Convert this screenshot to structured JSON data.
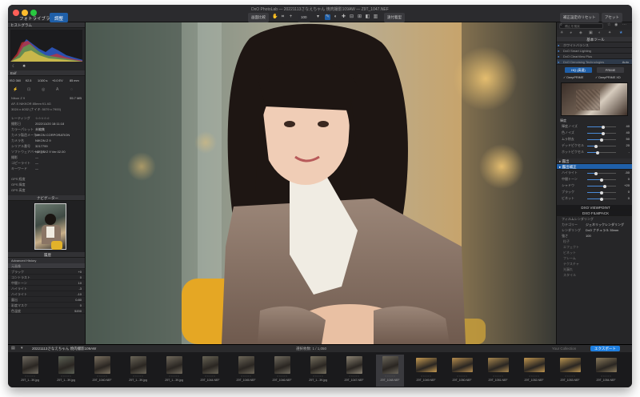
{
  "window": {
    "title": "DxO PhotoLab — 20221113さなえちゃん 焼肉撮影109AW — Z9T_1047.NEF"
  },
  "tabs": [
    {
      "label": "フォトライブラリ"
    },
    {
      "label": "調整"
    }
  ],
  "toolbar": {
    "compare_label": "画面比較",
    "zoom_value": "100",
    "wb_label": "遠付着型",
    "right_button_1": "補正設定のリセット",
    "right_button_2": "アセット"
  },
  "left_panel": {
    "histogram_title": "ヒストグラム",
    "exif_title": "Exif",
    "exif_values": [
      "ISO 360",
      "f/2.5",
      "1/100 s",
      "+0.0 EV",
      "85 mm"
    ],
    "camera": "Nikon Z 9",
    "camera_size": "55.7 MB",
    "lens": "AF-S NIKKOR 85mm f/1.4G",
    "file_info": "3024 x 4032 (ナイキ: 5079 x 7900)",
    "metadata": [
      {
        "label": "レーティング",
        "value": "☆☆☆☆☆"
      },
      {
        "label": "撮影日",
        "value": "2022/11/20 18:11:18"
      },
      {
        "label": "カラーパレット",
        "value": "未編集"
      },
      {
        "label": "カメラ製造メーカー",
        "value": "NIKON CORPORATION"
      },
      {
        "label": "カメラ名",
        "value": "NIKON Z 9"
      },
      {
        "label": "シリアル番号",
        "value": "3217799"
      },
      {
        "label": "ソフトウェアバージョン",
        "value": "NIKON Z 9 Ver.02.00"
      },
      {
        "label": "撮影",
        "value": "—"
      },
      {
        "label": "コピーライト",
        "value": "—"
      },
      {
        "label": "キーワード",
        "value": "—"
      }
    ],
    "gps": [
      {
        "label": "GPS 経度"
      },
      {
        "label": "GPS 緯度"
      },
      {
        "label": "GPS 高度"
      }
    ],
    "navigator_title": "ナビゲーター",
    "history_title": "履歴",
    "history_sub": "Advanced History",
    "history_items": [
      {
        "label": "元画像",
        "value": ""
      },
      {
        "label": "ブラック",
        "value": "+0"
      },
      {
        "label": "コントラスト",
        "value": "0"
      },
      {
        "label": "中間トーン",
        "value": "10"
      },
      {
        "label": "ハイライト",
        "value": "-3"
      },
      {
        "label": "ハイライト",
        "value": "-10"
      },
      {
        "label": "露出",
        "value": "0.80"
      },
      {
        "label": "彩度マスク",
        "value": "0"
      },
      {
        "label": "色温度",
        "value": "5200"
      }
    ]
  },
  "right_panel": {
    "search_placeholder": "補正を検索",
    "section_title": "基本ツール",
    "items": [
      {
        "label": "ホワイトバランス"
      },
      {
        "label": "DxO Smart Lighting"
      },
      {
        "label": "DxO ClearView Plus"
      },
      {
        "label": "DxO Denoising Technologies",
        "value": "Auto"
      }
    ],
    "denoise_options": [
      "HQ (高速)",
      "PRIME"
    ],
    "denoise_check": [
      "DeepPRIME",
      "DeepPRIME XD"
    ],
    "luminance_title": "輝度",
    "sliders": [
      {
        "label": "輝度ノイズ",
        "value": "40",
        "pos": 0.55
      },
      {
        "label": "色ノイズ",
        "value": "40",
        "pos": 0.55
      },
      {
        "label": "ムラ除去",
        "value": "50",
        "pos": 0.5
      },
      {
        "label": "デッドピクセル",
        "value": "20",
        "pos": 0.3
      },
      {
        "label": "ホットピクセル",
        "value": "-",
        "pos": 0.35
      }
    ],
    "sub_sections": [
      "露出",
      "露出補正"
    ],
    "tone_sliders": [
      {
        "label": "ハイライト",
        "value": "-50",
        "pos": 0.3
      },
      {
        "label": "中間トーン",
        "value": "0",
        "pos": 0.5
      },
      {
        "label": "シャドウ",
        "value": "+20",
        "pos": 0.6
      },
      {
        "label": "ブラック",
        "value": "0",
        "pos": 0.5
      },
      {
        "label": "ビネット",
        "value": "0",
        "pos": 0.5
      }
    ],
    "headers": [
      "DXO VIEWPOINT",
      "DXO FILMPACK"
    ],
    "filmpack_rows": [
      {
        "label": "フィルムレンダリング",
        "value": ""
      },
      {
        "label": "カテゴリー",
        "value": "ジェネリックレンダリング"
      },
      {
        "label": "レンダリング",
        "value": "DxO ナチュラル 35mm"
      },
      {
        "label": "強さ",
        "value": "100"
      }
    ],
    "extra_rows": [
      "粒子",
      "エフェクト",
      "ビネット",
      "フレーム",
      "テクスチャ",
      "光漏れ",
      "スタイル"
    ]
  },
  "filmstrip": {
    "folder": "20221113さなえちゃん 焼肉撮影109AW",
    "count": "1,050",
    "selected_count": "選択枚数: 1 / 1,050",
    "right_label": "Your Collection",
    "export_button": "エクスポート",
    "thumbs": [
      {
        "name": "Z9T_1...39.jpg"
      },
      {
        "name": "Z9T_1...39.jpg"
      },
      {
        "name": "Z9T_1040.NEF"
      },
      {
        "name": "Z9T_1...39.jpg"
      },
      {
        "name": "Z9T_1...39.jpg"
      },
      {
        "name": "Z9T_1044.NEF"
      },
      {
        "name": "Z9T_1045.NEF"
      },
      {
        "name": "Z9T_1046.NEF"
      },
      {
        "name": "Z9T_1...39.jpg"
      },
      {
        "name": "Z9T_1047.NEF"
      },
      {
        "name": "Z9T_1048.NEF"
      },
      {
        "name": "Z9T_1049.NEF"
      },
      {
        "name": "Z9T_1050.NEF"
      },
      {
        "name": "Z9T_1051.NEF"
      },
      {
        "name": "Z9T_1052.NEF"
      },
      {
        "name": "Z9T_1053.NEF"
      },
      {
        "name": "Z9T_1054.NEF"
      }
    ]
  }
}
